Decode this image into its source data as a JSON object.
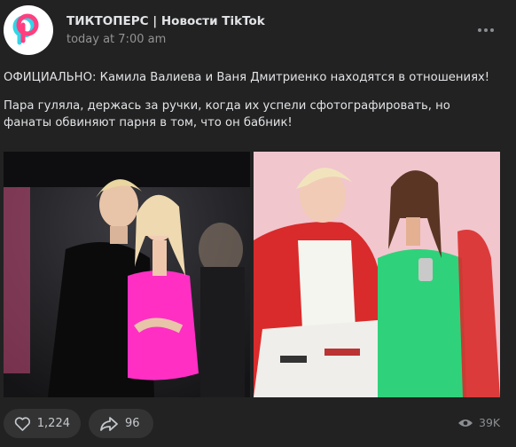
{
  "post": {
    "author": "ТИКТОПЕРС | Новости TikTok",
    "time": "today at 7:00 am",
    "text_line1": "ОФИЦИАЛЬНО: Камила Валиева и Ваня Дмитриенко находятся в отношениях!",
    "text_line2": "Пара гуляла, держась за ручки, когда их успели сфотографировать, но фанаты обвиняют парня в том, что он бабник!",
    "photos": [
      {
        "icon": "couple-photo-pink-dress"
      },
      {
        "icon": "couple-photo-green-dress"
      }
    ]
  },
  "actions": {
    "likes": "1,224",
    "shares": "96",
    "views": "39K"
  },
  "colors": {
    "background": "#222222",
    "pill": "#333333",
    "text": "#e1e3e6",
    "muted": "#939393",
    "brand_pink": "#ff3f7f",
    "brand_cyan": "#2fd6e8"
  }
}
